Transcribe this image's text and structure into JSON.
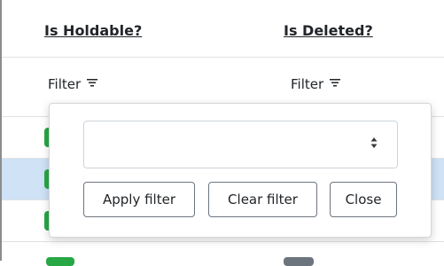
{
  "columns": [
    {
      "header": "Is Holdable?",
      "filter_label": "Filter"
    },
    {
      "header": "Is Deleted?",
      "filter_label": "Filter"
    }
  ],
  "filter_popup": {
    "select_value": "",
    "apply_label": "Apply filter",
    "clear_label": "Clear filter",
    "close_label": "Close"
  },
  "colors": {
    "badge_true": "#28a745",
    "badge_false": "#6c757d",
    "selected_row": "#cfe2f6"
  },
  "icons": {
    "filter": "filter-lines-icon",
    "select_arrow": "up-down-caret-icon"
  }
}
